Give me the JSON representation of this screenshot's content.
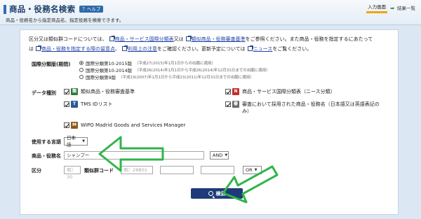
{
  "header": {
    "title": "商品・役務名検索",
    "help_label": "？ヘルプ",
    "subtitle": "商品・役務名から指定商品名、指定役務を検索できます。"
  },
  "steps": {
    "current": "入力画面",
    "arrow": "➡",
    "next": "結果一覧"
  },
  "intro": {
    "p1": "区分又は類似群コードについては、",
    "link1": "商品・サービス国際分類表",
    "p2": "又は",
    "link2": "類似商品・役務審査基準",
    "p3": "をご参照ください。また商品・役務を指定するにあたって",
    "p4": "は",
    "link3": "商品・役務を指定する際の留意点",
    "p5": "、",
    "link4": "利用上の注意",
    "p6": "をご確認ください。更新予定については",
    "link5": "ニュース",
    "p7": "をご覧ください。"
  },
  "form": {
    "edition_label": "国際分類版(期間)",
    "editions": [
      {
        "label": "国際分類第10-2015版",
        "note": "（平成27(2015)年1月1日からの出願に適用）",
        "selected": true
      },
      {
        "label": "国際分類第10-2014版",
        "note": "（平成26(2014)年1月1日から平成26(2014)年12月31日までの出願に適用）",
        "selected": false
      },
      {
        "label": "国際分類第9版",
        "note": "（平成19(2007)年1月1日から平成23(2011)年12月31日までの出願に適用）",
        "selected": false
      }
    ],
    "data_type_label": "データ種別",
    "data_types": [
      {
        "badge": "類",
        "label": "類似商品・役務審査基準",
        "checked": true
      },
      {
        "badge": "N",
        "label": "商品・サービス国際分類表（ニース分類）",
        "checked": true
      },
      {
        "badge": "T",
        "label": "TMS IDリスト",
        "checked": true
      },
      {
        "badge": "審",
        "label": "審査において採用された商品・役務名（日本語又は英語表記のみ）",
        "checked": true
      },
      {
        "badge": "M",
        "label": "WIPO Madrid Goods and Services Manager",
        "checked": true
      }
    ],
    "language_label": "使用する言語",
    "language_value": "日本語",
    "product_name_label": "商品・役務名",
    "product_name_value": "シャンプー",
    "operator_value": "AND",
    "class_label": "区分",
    "class_placeholder": "例）30",
    "code_label": "類似群コード",
    "code_placeholder": "例）28B01",
    "or_value": "OR",
    "search_label": "検索"
  },
  "colors": {
    "badge_rui": "#2f7a3b",
    "badge_n": "#c0302e",
    "badge_t": "#2a5a9a",
    "badge_shin": "#6b6b6b",
    "badge_m": "#8a5a1a",
    "annotation_arrow": "#2fb54a",
    "search_button": "#1e3a78"
  }
}
